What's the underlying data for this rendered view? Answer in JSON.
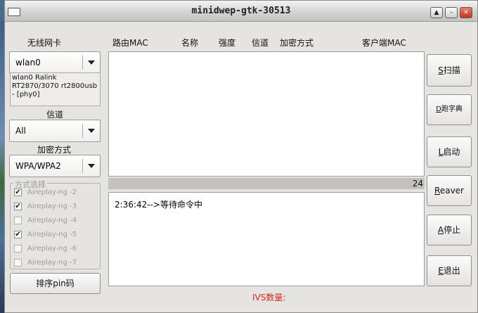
{
  "window": {
    "title": "minidwep-gtk-30513",
    "buttons": {
      "up": "▲",
      "minimize": "–",
      "close": "✕"
    }
  },
  "left": {
    "wireless_card_label": "无线网卡",
    "interface": "wlan0",
    "interface_info": "wlan0 Ralink RT2870/3070 rt2800usb - [phy0]",
    "channel_label": "信道",
    "channel_value": "All",
    "encryption_label": "加密方式",
    "encryption_value": "WPA/WPA2",
    "method_legend": "方式选择",
    "methods": [
      {
        "label": "Aireplay-ng -2",
        "checked": true,
        "mark": "✔"
      },
      {
        "label": "Aireplay-ng -3",
        "checked": true,
        "mark": "✔"
      },
      {
        "label": "Aireplay-ng -4",
        "checked": false,
        "mark": ""
      },
      {
        "label": "Aireplay-ng -5",
        "checked": true,
        "mark": "✔"
      },
      {
        "label": "Aireplay-ng -6",
        "checked": false,
        "mark": ""
      },
      {
        "label": "Aireplay-ng -7",
        "checked": false,
        "mark": ""
      }
    ],
    "sort_pin_button": "排序pin码"
  },
  "columns": [
    "路由MAC",
    "名称",
    "强度",
    "信道",
    "加密方式",
    "客户端MAC"
  ],
  "progress": {
    "value": "24"
  },
  "log": {
    "line": "2:36:42-->等待命令中"
  },
  "right_buttons": {
    "scan": {
      "mnemonic": "S",
      "rest": "扫描"
    },
    "dict": {
      "mnemonic": "D",
      "rest": "跑字典"
    },
    "launch": {
      "mnemonic": "L",
      "rest": "启动"
    },
    "reaver": {
      "mnemonic": "R",
      "rest": "eaver"
    },
    "stop": {
      "mnemonic": "A",
      "rest": "停止"
    },
    "exit": {
      "mnemonic": "E",
      "rest": "退出"
    }
  },
  "status": {
    "ivs_label": "IVS数量:"
  }
}
